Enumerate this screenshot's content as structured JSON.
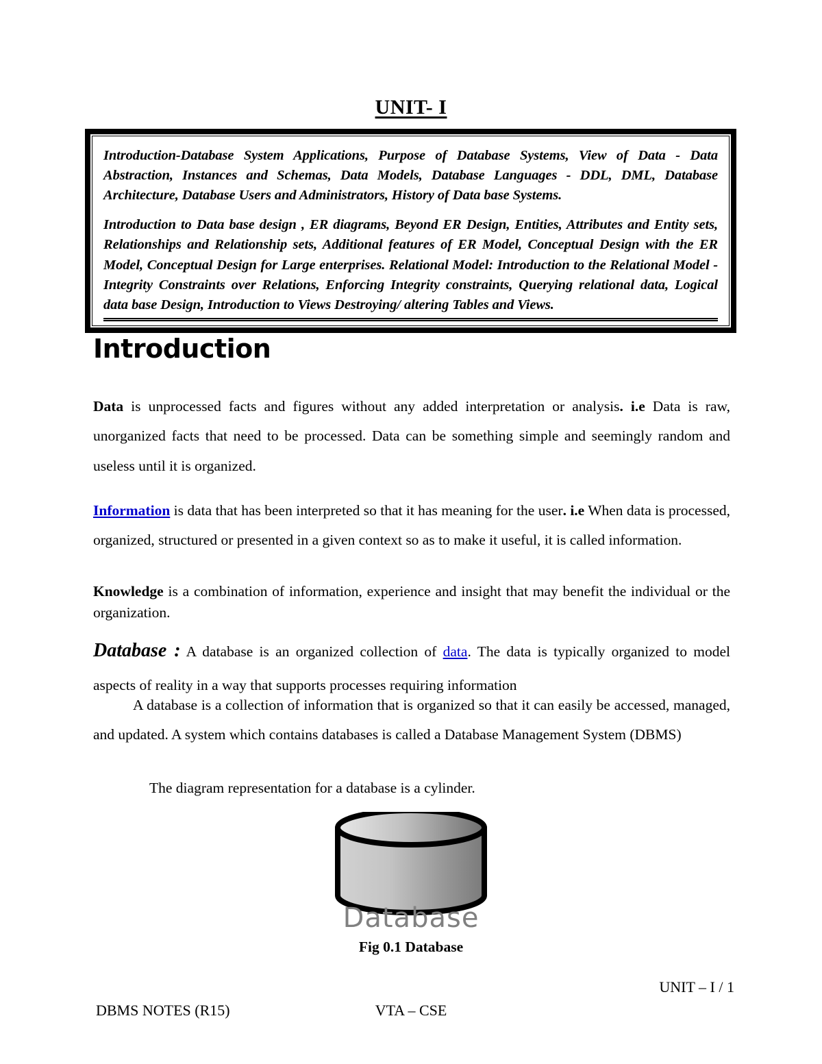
{
  "document": {
    "unit_title": "UNIT- I",
    "syllabus": {
      "paragraph_1": "Introduction-Database System Applications, Purpose of Database Systems, View of Data - Data Abstraction, Instances and Schemas, Data Models, Database Languages - DDL, DML, Database Architecture, Database Users and Administrators, History of Data base Systems.",
      "paragraph_2": "Introduction to Data base design , ER diagrams, Beyond ER Design, Entities, Attributes and Entity sets, Relationships and Relationship sets, Additional features of ER Model, Conceptual Design with the ER Model, Conceptual Design for Large enterprises. Relational Model: Introduction to the Relational Model - Integrity Constraints over Relations, Enforcing Integrity constraints, Querying relational data, Logical data base Design, Introduction to Views Destroying/ altering Tables and Views."
    },
    "section_heading": "Introduction",
    "data_paragraph": {
      "term": "Data",
      "text_1": " is unprocessed facts and figures without any added interpretation or analysis",
      "period": ".",
      "ie": " i.e",
      "text_2": " Data is raw, unorganized facts that need to be processed. Data can be something simple and seemingly random and useless until it is organized."
    },
    "information_paragraph": {
      "term": "Information",
      "text_1": " is data that has been interpreted so that it has meaning for the user",
      "period": ".",
      "ie": " i.e",
      "text_2": " When data is processed, organized, structured or presented in a given context so as to make it useful, it is called information."
    },
    "knowledge_paragraph": {
      "term": "Knowledge",
      "text": " is a combination of information, experience and insight that may benefit the individual or the organization."
    },
    "database_paragraph": {
      "term": "Database :",
      "text_1": " A database is an organized collection of ",
      "link": "data",
      "text_2": ". The data is typically organized to model aspects of reality in a way that supports processes requiring information"
    },
    "database_paragraph_2": "A database is a collection of information that is organized so that it can easily be accessed, managed, and updated. A system which contains databases is called a Database Management System (DBMS)",
    "diagram_intro": "The diagram representation for a database is a cylinder.",
    "figure": {
      "shape_label": "Database",
      "caption": "Fig 0.1 Database"
    },
    "footer": {
      "page_marker": "UNIT – I  /  1",
      "left": "DBMS NOTES  (R15)",
      "center": "VTA – CSE"
    },
    "colors": {
      "link": "#0000CC",
      "shape_label": "#808080",
      "border": "#000000"
    }
  }
}
